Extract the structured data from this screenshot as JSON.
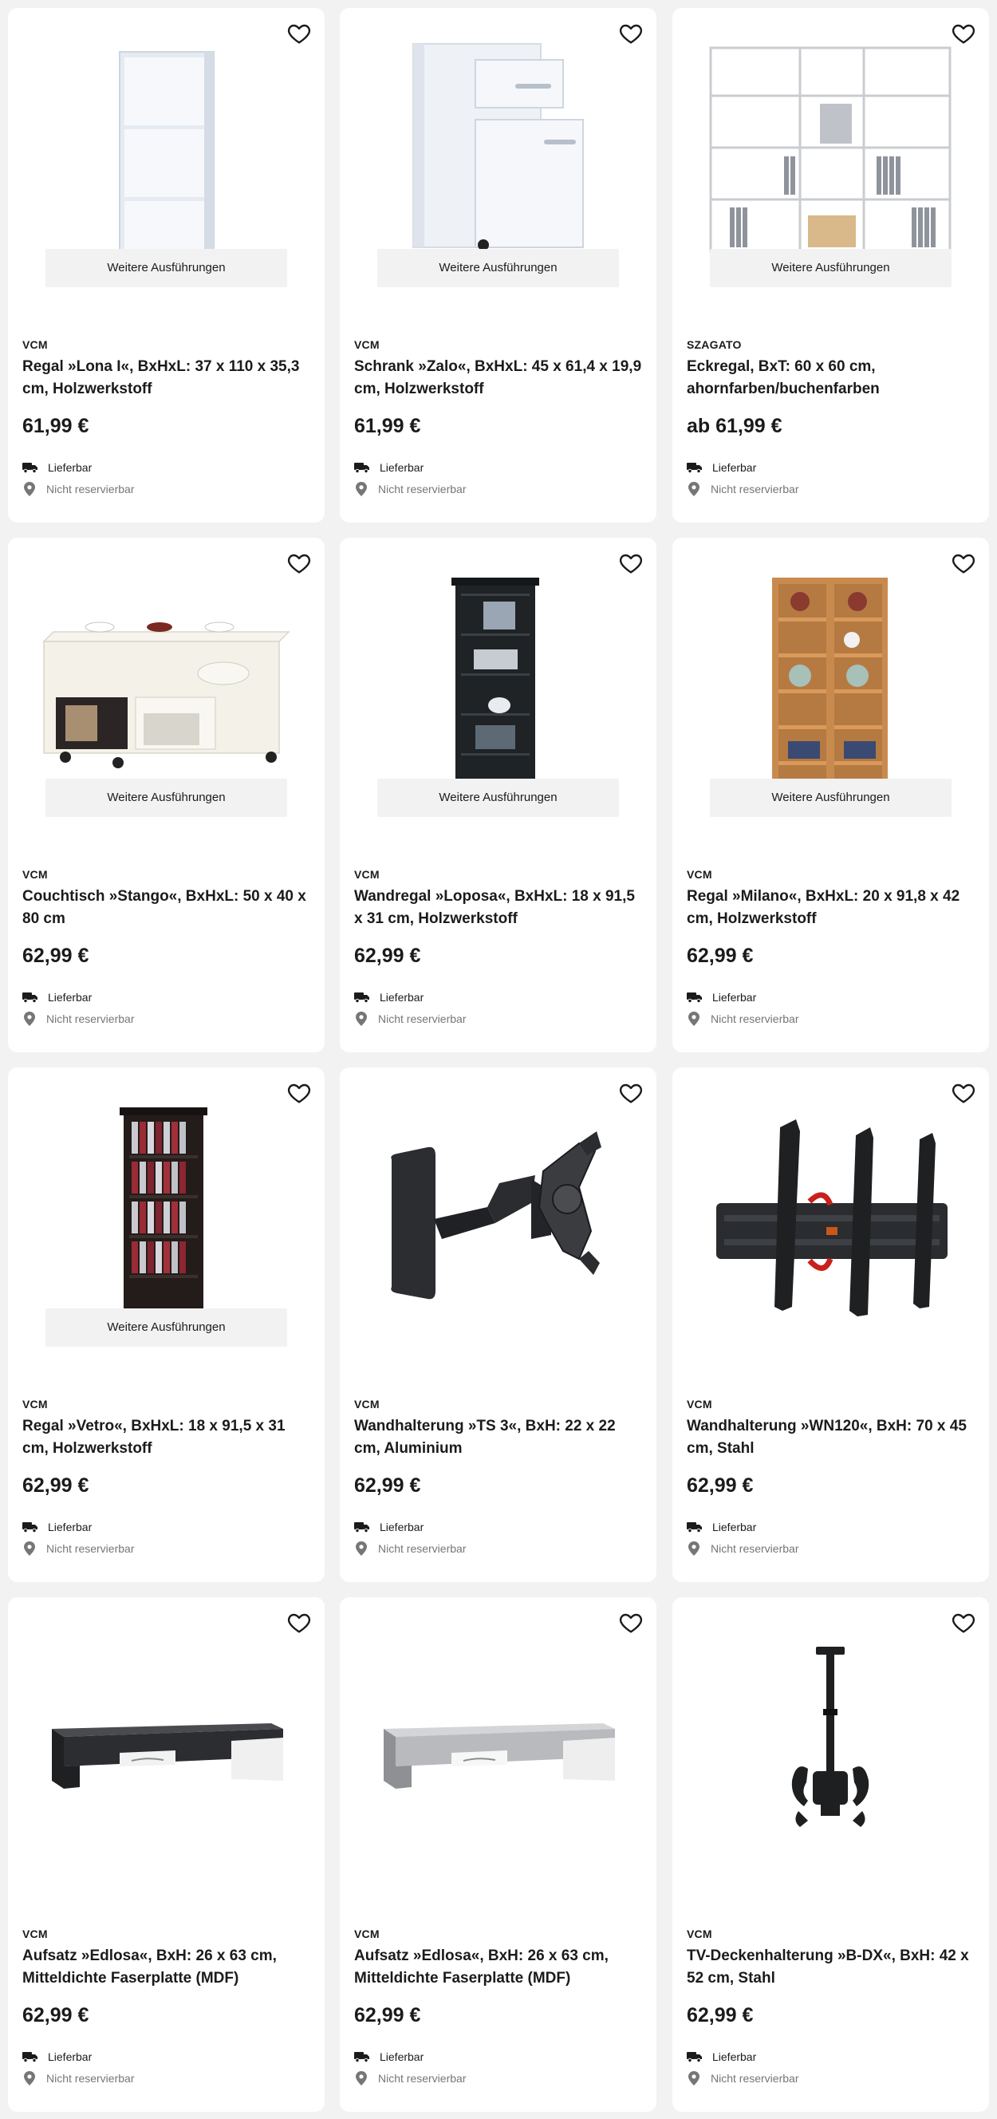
{
  "labels": {
    "variants": "Weitere Ausführungen",
    "delivery": "Lieferbar",
    "reserve": "Nicht reservierbar"
  },
  "icons": {
    "favorite": "heart-outline-icon",
    "delivery": "truck-icon",
    "reserve": "location-pin-icon"
  },
  "colors": {
    "page_background": "#f2f2f2",
    "card_background": "#ffffff",
    "text": "#1b1b1b",
    "muted_text": "#767676"
  },
  "products": [
    {
      "brand": "VCM",
      "title": "Regal »Lona I«, BxHxL: 37 x 110 x 35,3 cm, Holzwerkstoff",
      "price": "61,99 €",
      "has_variants": true,
      "image": "white-shelf"
    },
    {
      "brand": "VCM",
      "title": "Schrank »Zalo«, BxHxL: 45 x 61,4 x 19,9 cm, Holzwerkstoff",
      "price": "61,99 €",
      "has_variants": true,
      "image": "white-drawer-cabinet"
    },
    {
      "brand": "SZAGATO",
      "title": "Eckregal, BxT: 60 x 60 cm, ahornfarben/buchenfarben",
      "price": "ab 61,99 €",
      "has_variants": true,
      "image": "corner-shelf"
    },
    {
      "brand": "VCM",
      "title": "Couchtisch »Stango«, BxHxL: 50 x 40 x 80 cm",
      "price": "62,99 €",
      "has_variants": true,
      "image": "coffee-table"
    },
    {
      "brand": "VCM",
      "title": "Wandregal »Loposa«, BxHxL: 18 x 91,5 x 31 cm, Holzwerkstoff",
      "price": "62,99 €",
      "has_variants": true,
      "image": "black-tall-shelf"
    },
    {
      "brand": "VCM",
      "title": "Regal »Milano«, BxHxL: 20 x 91,8 x 42 cm, Holzwerkstoff",
      "price": "62,99 €",
      "has_variants": true,
      "image": "beech-shelf"
    },
    {
      "brand": "VCM",
      "title": "Regal »Vetro«, BxHxL: 18 x 91,5 x 31 cm, Holzwerkstoff",
      "price": "62,99 €",
      "has_variants": true,
      "image": "cd-tower"
    },
    {
      "brand": "VCM",
      "title": "Wandhalterung »TS 3«, BxH: 22 x 22 cm, Aluminium",
      "price": "62,99 €",
      "has_variants": false,
      "image": "swivel-wall-mount"
    },
    {
      "brand": "VCM",
      "title": "Wandhalterung »WN120«, BxH: 70 x 45 cm, Stahl",
      "price": "62,99 €",
      "has_variants": false,
      "image": "tilt-wall-mount"
    },
    {
      "brand": "VCM",
      "title": "Aufsatz »Edlosa«, BxH: 26 x 63 cm, Mitteldichte Faserplatte (MDF)",
      "price": "62,99 €",
      "has_variants": false,
      "image": "black-monitor-riser"
    },
    {
      "brand": "VCM",
      "title": "Aufsatz »Edlosa«, BxH: 26 x 63 cm, Mitteldichte Faserplatte (MDF)",
      "price": "62,99 €",
      "has_variants": false,
      "image": "grey-monitor-riser"
    },
    {
      "brand": "VCM",
      "title": "TV-Deckenhalterung »B-DX«, BxH: 42 x 52 cm, Stahl",
      "price": "62,99 €",
      "has_variants": false,
      "image": "ceiling-mount"
    }
  ]
}
